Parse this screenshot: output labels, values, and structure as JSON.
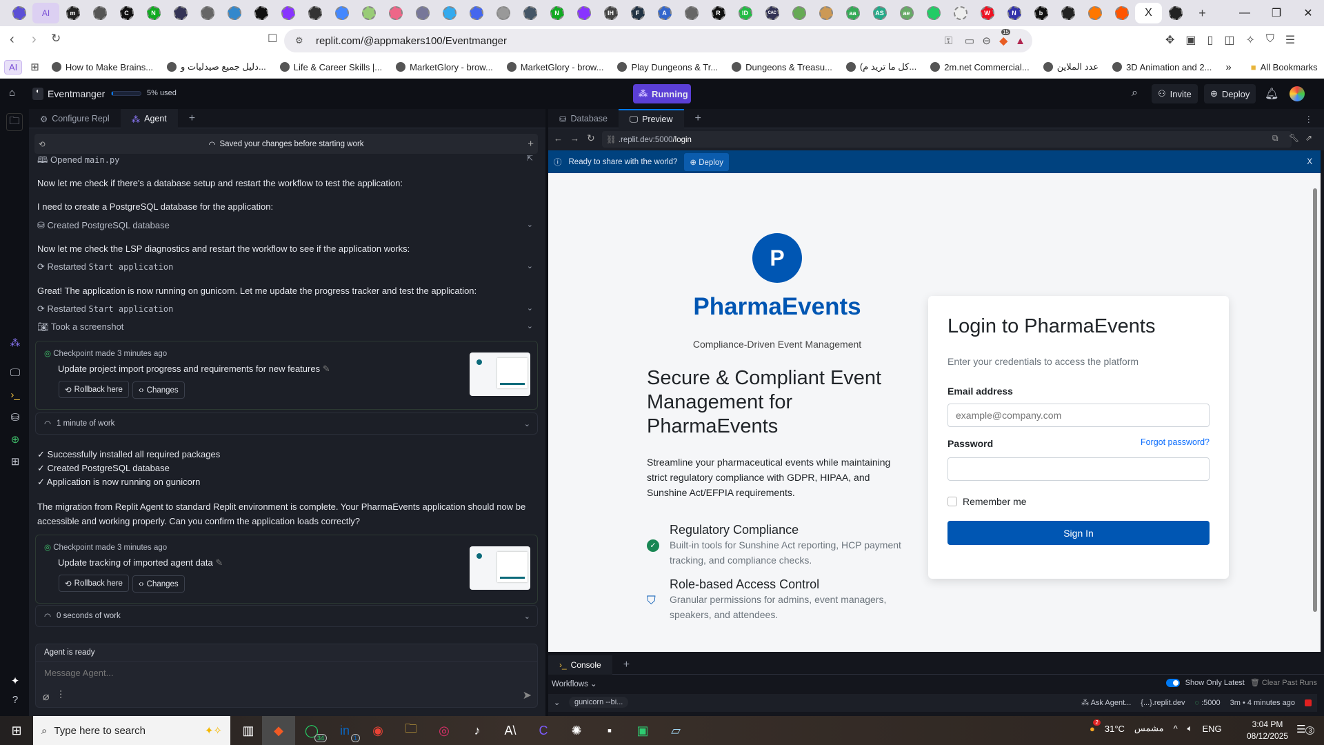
{
  "browser": {
    "tabs": [
      "replit",
      "AI",
      "m",
      "bot",
      "C",
      "N",
      "play",
      "globe",
      "shield",
      "target",
      "spiral",
      "github",
      "gemini",
      "rainbow",
      "share",
      "cube",
      "circle",
      "owl",
      "back",
      "book",
      "N",
      "spiral",
      "IH",
      "F",
      "A",
      "globe",
      "R",
      "ID",
      "CAC",
      "cat",
      "search",
      "aa",
      "AS",
      "ae",
      "asterisk",
      "arrow",
      "W",
      "N",
      "b",
      "flower",
      "dots",
      "reddit",
      "close",
      "github"
    ],
    "active_tab_close": "X",
    "url": "replit.com/@appmakers100/Eventmanger",
    "shield_count": "15",
    "bookmarks": [
      "AI",
      "How to Make Brains...",
      "دليل جميع صيدليات و...",
      "Life & Career Skills |...",
      "MarketGlory - brow...",
      "MarketGlory - brow...",
      "Play Dungeons & Tr...",
      "Dungeons & Treasu...",
      "(كل ما تريد م...",
      "2m.net Commercial...",
      "عدد الملاين",
      "3D Animation and 2..."
    ],
    "more": "»",
    "all_bookmarks": "All Bookmarks"
  },
  "replit": {
    "project": "Eventmanger",
    "usage": "5% used",
    "usage_fraction": 0.05,
    "run_status": "Running",
    "invite": "Invite",
    "deploy": "Deploy",
    "left_tabs": [
      "Configure Repl",
      "Agent"
    ],
    "saved": "Saved your changes before starting work",
    "opened_prefix": "Opened ",
    "opened_file": "main.py",
    "msg1": "Now let me check if there's a database setup and restart the workflow to test the application:",
    "msg2": "I need to create a PostgreSQL database for the application:",
    "action_db": "Created PostgreSQL database",
    "msg3": "Now let me check the LSP diagnostics and restart the workflow to see if the application works:",
    "restarted": "Restarted ",
    "restart_target": "Start application",
    "msg4": "Great! The application is now running on gunicorn. Let me update the progress tracker and test the application:",
    "screenshot": "Took a screenshot",
    "checkpoints": [
      {
        "time": "Checkpoint made 3 minutes ago",
        "title": "Update project import progress and requirements for new features",
        "rollback": "Rollback here",
        "changes": "Changes",
        "work": "1 minute of work"
      },
      {
        "time": "Checkpoint made 3 minutes ago",
        "title": "Update tracking of imported agent data",
        "rollback": "Rollback here",
        "changes": "Changes",
        "work": "0 seconds of work"
      }
    ],
    "checks": [
      "✓ Successfully installed all required packages",
      "✓ Created PostgreSQL database",
      "✓ Application is now running on gunicorn"
    ],
    "final_msg": "The migration from Replit Agent to standard Replit environment is complete. Your PharmaEvents application should now be accessible and working properly. Can you confirm the application loads correctly?",
    "agent_status": "Agent is ready",
    "message_placeholder": "Message Agent...",
    "right_tabs": [
      "Database",
      "Preview"
    ],
    "preview_url_host": ".replit.dev:5000",
    "preview_url_path": "/login",
    "banner_text": "Ready to share with the world?",
    "banner_deploy": "Deploy",
    "banner_close": "X",
    "console_tab": "Console",
    "workflows": "Workflows",
    "show_latest": "Show Only Latest",
    "clear_runs": "Clear Past Runs",
    "run_name": "gunicorn --bi...",
    "ask_agent": "Ask Agent...",
    "domain": "{...}.replit.dev",
    "port": ":5000",
    "run_time": "3m • 4 minutes ago"
  },
  "app": {
    "logo_letter": "P",
    "brand": "PharmaEvents",
    "tagline": "Compliance-Driven Event Management",
    "headline": "Secure & Compliant Event Management for PharmaEvents",
    "description": "Streamline your pharmaceutical events while maintaining strict regulatory compliance with GDPR, HIPAA, and Sunshine Act/EFPIA requirements.",
    "features": [
      {
        "title": "Regulatory Compliance",
        "text": "Built-in tools for Sunshine Act reporting, HCP payment tracking, and compliance checks."
      },
      {
        "title": "Role-based Access Control",
        "text": "Granular permissions for admins, event managers, speakers, and attendees."
      }
    ],
    "login_title": "Login to PharmaEvents",
    "login_sub": "Enter your credentials to access the platform",
    "email_label": "Email address",
    "email_placeholder": "example@company.com",
    "password_label": "Password",
    "forgot": "Forgot password?",
    "remember": "Remember me",
    "sign_in": "Sign In",
    "colors": {
      "primary": "#0056b3",
      "success": "#198754"
    }
  },
  "taskbar": {
    "search": "Type here to search",
    "whatsapp_badge": "34",
    "linkedin_badge": "1",
    "weather_badge": "2",
    "temp": "31°C",
    "weather": "مشمس",
    "lang": "ENG",
    "time": "3:04 PM",
    "date": "08/12/2025",
    "notif": "3"
  }
}
